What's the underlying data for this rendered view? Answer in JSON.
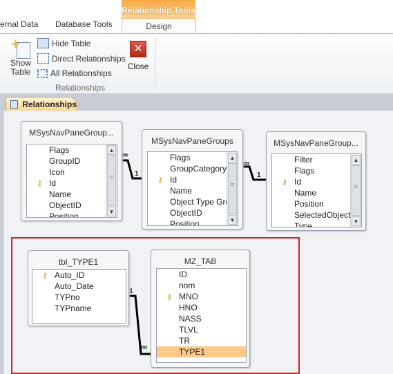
{
  "ribbon": {
    "tabs": [
      "ernal Data",
      "Database Tools"
    ],
    "contextual_title": "Relationship Tools",
    "active_tab": "Design",
    "buttons": {
      "show_table": "Show Table",
      "hide_table": "Hide Table",
      "direct_relationships": "Direct Relationships",
      "all_relationships": "All Relationships",
      "close": "Close"
    },
    "group_label": "Relationships"
  },
  "document_tab": "Relationships",
  "tables": [
    {
      "name": "MSysNavPaneGroup...",
      "fields": [
        "Flags",
        "GroupID",
        "Icon",
        "Id",
        "Name",
        "ObjectID",
        "Position"
      ],
      "key": "Id"
    },
    {
      "name": "MSysNavPaneGroups",
      "fields": [
        "Flags",
        "GroupCategory",
        "Id",
        "Name",
        "Object Type Gro",
        "ObjectID",
        "Position"
      ],
      "key": "Id"
    },
    {
      "name": "MSysNavPaneGroup...",
      "fields": [
        "Filter",
        "Flags",
        "Id",
        "Name",
        "Position",
        "SelectedObjectI",
        "Type"
      ],
      "key": "Id"
    },
    {
      "name": "tbl_TYPE1",
      "fields": [
        "Auto_ID",
        "Auto_Date",
        "TYPno",
        "TYPname"
      ],
      "key": "Auto_ID"
    },
    {
      "name": "MZ_TAB",
      "fields": [
        "ID",
        "nom",
        "MNO",
        "HNO",
        "NASS",
        "TLVL",
        "TR",
        "TYPE1"
      ],
      "key": "MNO",
      "selected": "TYPE1"
    }
  ],
  "relationship_labels": {
    "one": "1",
    "many": "∞"
  },
  "colors": {
    "accent": "#f7a742",
    "highlight": "#fbc98a",
    "selection_box": "#d42020"
  }
}
